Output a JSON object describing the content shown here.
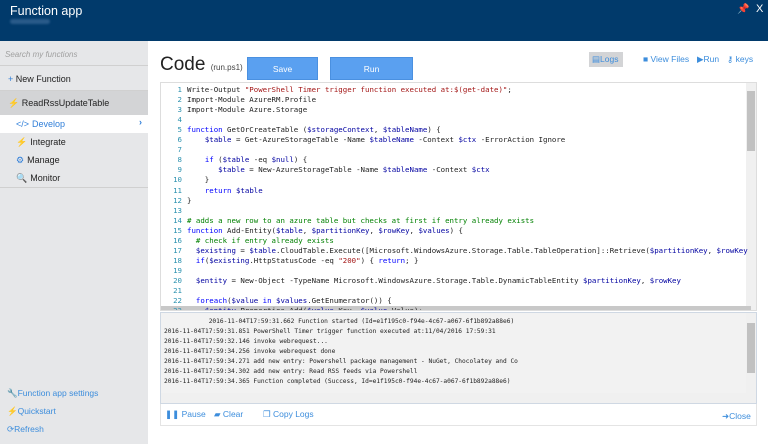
{
  "header": {
    "title": "Function app",
    "pin_icon": "pin-icon",
    "close_label": "X"
  },
  "sidebar": {
    "search_placeholder": "Search my functions",
    "new_function": "New Function",
    "function_name": "ReadRssUpdateTable",
    "nav": [
      {
        "label": "Develop",
        "icon": "</>"
      },
      {
        "label": "Integrate",
        "icon": "⚡"
      },
      {
        "label": "Manage",
        "icon": "⚙"
      },
      {
        "label": "Monitor",
        "icon": "🔍"
      }
    ],
    "footer": [
      {
        "label": "Function app settings",
        "icon": "🔧"
      },
      {
        "label": "Quickstart",
        "icon": "⚡"
      },
      {
        "label": "Refresh",
        "icon": "⟳"
      }
    ]
  },
  "main": {
    "title": "Code",
    "filename": "(run.ps1)",
    "save": "Save",
    "run": "Run",
    "logs": "Logs",
    "view_files": "View Files",
    "run_link": "Run",
    "keys": "keys"
  },
  "code_lines": [
    "Write-Output \"PowerShell Timer trigger function executed at:$(get-date)\";",
    "Import-Module AzureRM.Profile",
    "Import-Module Azure.Storage",
    "",
    "function GetOrCreateTable ($storageContext, $tableName) {",
    "    $table = Get-AzureStorageTable -Name $tableName -Context $ctx -ErrorAction Ignore",
    "",
    "    if ($table -eq $null) {",
    "       $table = New-AzureStorageTable -Name $tableName -Context $ctx",
    "    }",
    "    return $table",
    "}",
    "",
    "# adds a new row to an azure table but checks at first if entry already exists",
    "function Add-Entity($table, $partitionKey, $rowKey, $values) {",
    "  # check if entry already exists",
    "  $existing = $table.CloudTable.Execute([Microsoft.WindowsAzure.Storage.Table.TableOperation]::Retrieve($partitionKey, $rowKey",
    "  if($existing.HttpStatusCode -eq \"200\") { return; }",
    "",
    "  $entity = New-Object -TypeName Microsoft.WindowsAzure.Storage.Table.DynamicTableEntity $partitionKey, $rowKey",
    "",
    "  foreach($value in $values.GetEnumerator()) {",
    "    $entity.Properties.Add($value.Key, $value.Value);"
  ],
  "log_lines": [
    "            2016-11-04T17:59:31.662 Function started (Id=e1f195c0-f94e-4c67-a067-6f1b892a88e6)",
    "2016-11-04T17:59:31.851 PowerShell Timer trigger function executed at:11/04/2016 17:59:31",
    "2016-11-04T17:59:32.146 invoke webrequest...",
    "2016-11-04T17:59:34.256 invoke webrequest done",
    "2016-11-04T17:59:34.271 add new entry: Powershell package management - NuGet, Chocolatey and Co",
    "2016-11-04T17:59:34.302 add new entry: Read RSS feeds via Powershell",
    "2016-11-04T17:59:34.365 Function completed (Success, Id=e1f195c0-f94e-4c67-a067-6f1b892a88e6)"
  ],
  "logbar": {
    "pause": "Pause",
    "clear": "Clear",
    "copy": "Copy Logs",
    "close": "Close"
  }
}
